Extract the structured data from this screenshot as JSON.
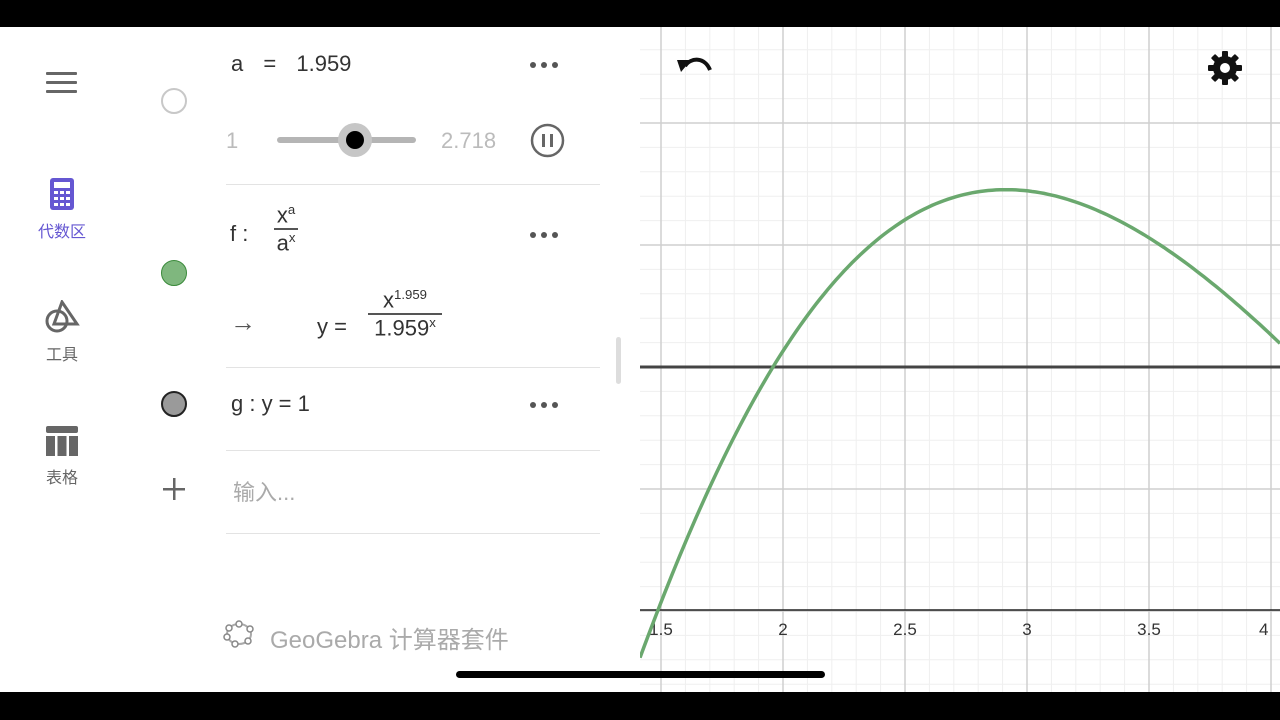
{
  "nav": {
    "items": [
      {
        "label": "代数区",
        "icon": "calculator-icon",
        "active": true
      },
      {
        "label": "工具",
        "icon": "tools-icon",
        "active": false
      },
      {
        "label": "表格",
        "icon": "table-icon",
        "active": false
      }
    ]
  },
  "algebra": {
    "slider": {
      "name": "a",
      "eq": "=",
      "value": "1.959",
      "min": "1",
      "max": "2.718",
      "fraction": 0.56
    },
    "function_f": {
      "name": "f :",
      "numerator_base": "x",
      "numerator_exp": "a",
      "denominator_base": "a",
      "denominator_exp": "x",
      "arrow": "→",
      "result_lhs": "y =",
      "result_num_base": "x",
      "result_num_exp": "1.959",
      "result_den_base": "1.959",
      "result_den_exp": "x",
      "color": "#7fb77e"
    },
    "function_g": {
      "text": "g :  y  =  1",
      "color": "#9a9a9a"
    },
    "input_placeholder": "输入...",
    "footer": "GeoGebra 计算器套件"
  },
  "graph": {
    "x_ticks": [
      "1.5",
      "2",
      "2.5",
      "3",
      "3.5",
      "4"
    ],
    "curve_color": "#6aa86e",
    "line_color": "#444444",
    "a_value": 1.959,
    "g_value": 1
  }
}
